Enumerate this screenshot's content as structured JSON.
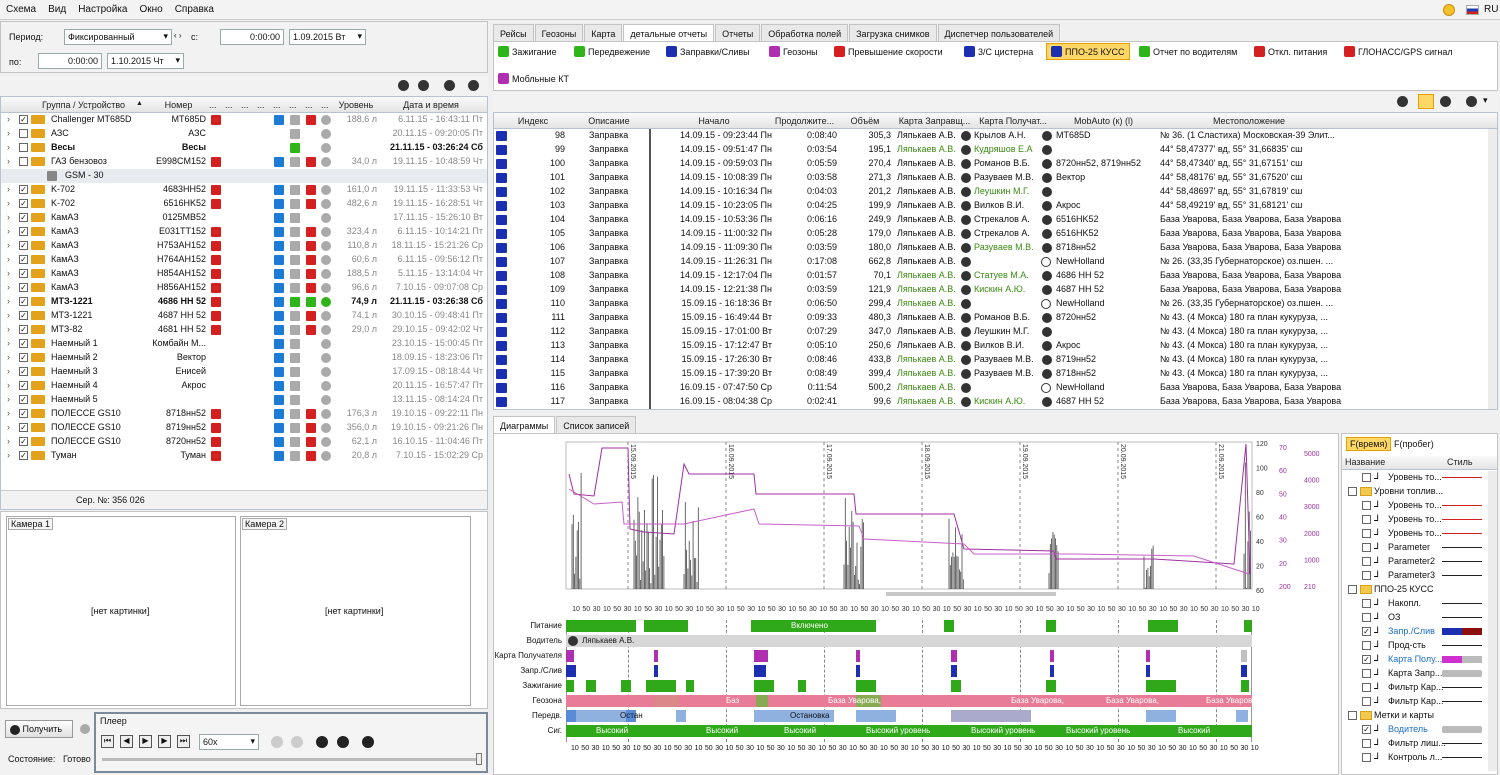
{
  "menu": [
    "Схема",
    "Вид",
    "Настройка",
    "Окно",
    "Справка"
  ],
  "locale": "RU",
  "period": {
    "label": "Период:",
    "mode": "Фиксированный",
    "from_label": "с:",
    "from_time": "0:00:00",
    "from_date": "1.09.2015 Вт",
    "to_label": "по:",
    "to_time": "0:00:00",
    "to_date": "1.10.2015 Чт"
  },
  "device_table": {
    "headers": {
      "group": "Группа / Устройство",
      "number": "Номер",
      "dots": "...",
      "level": "Уровень",
      "datetime": "Дата и время"
    },
    "rows": [
      {
        "name": "Challenger MT685D",
        "number": "MT685D",
        "level": "188,6 л",
        "dt": "6.11.15 - 16:43:11 Пт",
        "checked": true,
        "bold": false
      },
      {
        "name": "АЗС",
        "number": "АЗС",
        "level": "",
        "dt": "20.11.15 - 09:20:05 Пт",
        "checked": false,
        "bold": false
      },
      {
        "name": "Весы",
        "number": "Весы",
        "level": "",
        "dt": "21.11.15 - 03:26:24 Сб",
        "checked": false,
        "bold": true
      },
      {
        "name": "ГАЗ бензовоз",
        "number": "E998CM152",
        "level": "34,0 л",
        "dt": "19.11.15 - 10:48:59 Чт",
        "checked": false,
        "bold": false
      },
      {
        "name": "GSM - 30",
        "number": "",
        "level": "",
        "dt": "",
        "checked": false,
        "bold": false,
        "sub": true
      },
      {
        "name": "K-702",
        "number": "4683HH52",
        "level": "161,0 л",
        "dt": "19.11.15 - 11:33:53 Чт",
        "checked": true,
        "bold": false
      },
      {
        "name": "K-702",
        "number": "6516HK52",
        "level": "482,6 л",
        "dt": "19.11.15 - 16:28:51 Чт",
        "checked": true,
        "bold": false
      },
      {
        "name": "КамАЗ",
        "number": "0125MB52",
        "level": "",
        "dt": "17.11.15 - 15:26:10 Вт",
        "checked": true,
        "bold": false
      },
      {
        "name": "КамАЗ",
        "number": "E031TT152",
        "level": "323,4 л",
        "dt": "6.11.15 - 10:14:21 Пт",
        "checked": true,
        "bold": false
      },
      {
        "name": "КамАЗ",
        "number": "H753AH152",
        "level": "110,8 л",
        "dt": "18.11.15 - 15:21:26 Ср",
        "checked": true,
        "bold": false
      },
      {
        "name": "КамАЗ",
        "number": "H764AH152",
        "level": "60,6 л",
        "dt": "6.11.15 - 09:56:12 Пт",
        "checked": true,
        "bold": false
      },
      {
        "name": "КамАЗ",
        "number": "H854AH152",
        "level": "188,5 л",
        "dt": "5.11.15 - 13:14:04 Чт",
        "checked": true,
        "bold": false
      },
      {
        "name": "КамАЗ",
        "number": "H856AH152",
        "level": "96,6 л",
        "dt": "7.10.15 - 09:07:08 Ср",
        "checked": true,
        "bold": false
      },
      {
        "name": "МТЗ-1221",
        "number": "4686 HH 52",
        "level": "74,9 л",
        "dt": "21.11.15 - 03:26:38 Сб",
        "checked": true,
        "bold": true
      },
      {
        "name": "МТЗ-1221",
        "number": "4687 HH 52",
        "level": "74,1 л",
        "dt": "30.10.15 - 09:48:41 Пт",
        "checked": true,
        "bold": false
      },
      {
        "name": "МТЗ-82",
        "number": "4681 HH 52",
        "level": "29,0 л",
        "dt": "29.10.15 - 09:42:02 Чт",
        "checked": true,
        "bold": false
      },
      {
        "name": "Наемный 1",
        "number": "Комбайн М...",
        "level": "",
        "dt": "23.10.15 - 15:00:45 Пт",
        "checked": true,
        "bold": false
      },
      {
        "name": "Наемный 2",
        "number": "Вектор",
        "level": "",
        "dt": "18.09.15 - 18:23:06 Пт",
        "checked": true,
        "bold": false
      },
      {
        "name": "Наемный 3",
        "number": "Енисей",
        "level": "",
        "dt": "17.09.15 - 08:18:44 Чт",
        "checked": true,
        "bold": false
      },
      {
        "name": "Наемный 4",
        "number": "Акрос",
        "level": "",
        "dt": "20.11.15 - 16:57:47 Пт",
        "checked": true,
        "bold": false
      },
      {
        "name": "Наемный 5",
        "number": "",
        "level": "",
        "dt": "13.11.15 - 08:14:24 Пт",
        "checked": true,
        "bold": false
      },
      {
        "name": "ПОЛЕССЕ GS10",
        "number": "8718нн52",
        "level": "176,3 л",
        "dt": "19.10.15 - 09:22:11 Пн",
        "checked": true,
        "bold": false
      },
      {
        "name": "ПОЛЕССЕ GS10",
        "number": "8719нн52",
        "level": "356,0 л",
        "dt": "19.10.15 - 09:21:26 Пн",
        "checked": true,
        "bold": false
      },
      {
        "name": "ПОЛЕССЕ GS10",
        "number": "8720нн52",
        "level": "62,1 л",
        "dt": "16.10.15 - 11:04:46 Пт",
        "checked": true,
        "bold": false
      },
      {
        "name": "Туман",
        "number": "Туман",
        "level": "20,8 л",
        "dt": "7.10.15 - 15:02:29 Ср",
        "checked": true,
        "bold": false
      }
    ]
  },
  "serial": "Сер. №: 356 026",
  "cameras": {
    "cam1": "Камера 1",
    "cam2": "Камера 2",
    "no_image": "[нет картинки]"
  },
  "bottom": {
    "get": "Получить",
    "state_label": "Состояние:",
    "state": "Готово",
    "player": "Плеер",
    "speed": "60x"
  },
  "main_tabs": [
    "Рейсы",
    "Геозоны",
    "Карта",
    "детальные отчеты",
    "Отчеты",
    "Обработка полей",
    "Загрузка снимков",
    "Диспетчер пользователей"
  ],
  "report_buttons": [
    "Зажигание",
    "Передвежение",
    "Заправки/Сливы",
    "Геозоны",
    "Превышение скорости",
    "3/С цистерна",
    "ППО-25 КУСС",
    "Отчет по водителям",
    "Откл. питания",
    "ГЛОНАСС/GPS сигнал",
    "Мобльные КТ"
  ],
  "report_table": {
    "headers": [
      "Индекс",
      "Описание",
      "Начало",
      "Продолжите...",
      "Объём",
      "Карта Заправщ...",
      "Карта Получат...",
      "MobAuto (к) (l)",
      "Местоположение"
    ],
    "rows": [
      [
        "98",
        "Заправка",
        "14.09.15 - 09:23:44 Пн",
        "0:08:40",
        "305,3",
        "Ляпькаев А.В.",
        "Крылов А.Н.",
        "MT685D",
        "№ 36. (1 Сластиха) Московская-39 Элит..."
      ],
      [
        "99",
        "Заправка",
        "14.09.15 - 09:51:47 Пн",
        "0:03:54",
        "195,1",
        "Ляпькаев А.В.",
        "Кудряшов Е.А",
        "",
        "44° 58,47377' вд, 55° 31,66835' сш"
      ],
      [
        "100",
        "Заправка",
        "14.09.15 - 09:59:03 Пн",
        "0:05:59",
        "270,4",
        "Ляпькаев А.В.",
        "Романов В.Б.",
        "8720нн52, 8719нн52",
        "44° 58,47340' вд, 55° 31,67151' сш"
      ],
      [
        "101",
        "Заправка",
        "14.09.15 - 10:08:39 Пн",
        "0:03:58",
        "271,3",
        "Ляпькаев А.В.",
        "Разуваев М.В.",
        "Вектор",
        "44° 58,48176' вд, 55° 31,67520' сш"
      ],
      [
        "102",
        "Заправка",
        "14.09.15 - 10:16:34 Пн",
        "0:04:03",
        "201,2",
        "Ляпькаев А.В.",
        "Леушкин М.Г.",
        "",
        "44° 58,48697' вд, 55° 31,67819' сш"
      ],
      [
        "103",
        "Заправка",
        "14.09.15 - 10:23:05 Пн",
        "0:04:25",
        "199,9",
        "Ляпькаев А.В.",
        "Вилков В.И.",
        "Акрос",
        "44° 58,49219' вд, 55° 31,68121' сш"
      ],
      [
        "104",
        "Заправка",
        "14.09.15 - 10:53:36 Пн",
        "0:06:16",
        "249,9",
        "Ляпькаев А.В.",
        "Стрекалов А.",
        "6516HK52",
        "База Уварова, База Уварова, База Уварова"
      ],
      [
        "105",
        "Заправка",
        "14.09.15 - 11:00:32 Пн",
        "0:05:28",
        "179,0",
        "Ляпькаев А.В.",
        "Стрекалов А.",
        "6516HK52",
        "База Уварова, База Уварова, База Уварова"
      ],
      [
        "106",
        "Заправка",
        "14.09.15 - 11:09:30 Пн",
        "0:03:59",
        "180,0",
        "Ляпькаев А.В.",
        "Разуваев М.В.",
        "8718нн52",
        "База Уварова, База Уварова, База Уварова"
      ],
      [
        "107",
        "Заправка",
        "14.09.15 - 11:26:31 Пн",
        "0:17:08",
        "662,8",
        "Ляпькаев А.В.",
        "",
        "NewHolland",
        "№ 26. (33,35 Губернаторское) оз.пшен. ..."
      ],
      [
        "108",
        "Заправка",
        "14.09.15 - 12:17:04 Пн",
        "0:01:57",
        "70,1",
        "Ляпькаев А.В.",
        "Статуев М.А.",
        "4686 HH 52",
        "База Уварова, База Уварова, База Уварова"
      ],
      [
        "109",
        "Заправка",
        "14.09.15 - 12:21:38 Пн",
        "0:03:59",
        "121,9",
        "Ляпькаев А.В.",
        "Кискин А.Ю.",
        "4687 HH 52",
        "База Уварова, База Уварова, База Уварова"
      ],
      [
        "110",
        "Заправка",
        "15.09.15 - 16:18:36 Вт",
        "0:06:50",
        "299,4",
        "Ляпькаев А.В.",
        "",
        "NewHolland",
        "№ 26. (33,35 Губернаторское) оз.пшен. ..."
      ],
      [
        "111",
        "Заправка",
        "15.09.15 - 16:49:44 Вт",
        "0:09:33",
        "480,3",
        "Ляпькаев А.В.",
        "Романов В.Б.",
        "8720нн52",
        "№ 43. (4 Мокса) 180 га план кукуруза, ..."
      ],
      [
        "112",
        "Заправка",
        "15.09.15 - 17:01:00 Вт",
        "0:07:29",
        "347,0",
        "Ляпькаев А.В.",
        "Леушкин М.Г.",
        "",
        "№ 43. (4 Мокса) 180 га план кукуруза, ..."
      ],
      [
        "113",
        "Заправка",
        "15.09.15 - 17:12:47 Вт",
        "0:05:10",
        "250,6",
        "Ляпькаев А.В.",
        "Вилков В.И.",
        "Акрос",
        "№ 43. (4 Мокса) 180 га план кукуруза, ..."
      ],
      [
        "114",
        "Заправка",
        "15.09.15 - 17:26:30 Вт",
        "0:08:46",
        "433,8",
        "Ляпькаев А.В.",
        "Разуваев М.В.",
        "8719нн52",
        "№ 43. (4 Мокса) 180 га план кукуруза, ..."
      ],
      [
        "115",
        "Заправка",
        "15.09.15 - 17:39:20 Вт",
        "0:08:49",
        "399,4",
        "Ляпькаев А.В.",
        "Разуваев М.В.",
        "8718нн52",
        "№ 43. (4 Мокса) 180 га план кукуруза, ..."
      ],
      [
        "116",
        "Заправка",
        "16.09.15 - 07:47:50 Ср",
        "0:11:54",
        "500,2",
        "Ляпькаев А.В.",
        "",
        "NewHolland",
        "База Уварова, База Уварова, База Уварова"
      ],
      [
        "117",
        "Заправка",
        "16.09.15 - 08:04:38 Ср",
        "0:02:41",
        "99,6",
        "Ляпькаев А.В.",
        "Кискин А.Ю.",
        "4687 HH 52",
        "База Уварова, База Уварова, База Уварова"
      ]
    ],
    "green_cells": [
      [
        1,
        5
      ],
      [
        1,
        6
      ],
      [
        4,
        6
      ],
      [
        8,
        6
      ],
      [
        10,
        5
      ],
      [
        10,
        6
      ],
      [
        11,
        5
      ],
      [
        11,
        6
      ],
      [
        12,
        5
      ],
      [
        16,
        5
      ],
      [
        17,
        5
      ],
      [
        18,
        5
      ],
      [
        19,
        5
      ],
      [
        19,
        6
      ]
    ]
  },
  "lower_tabs": [
    "Диаграммы",
    "Список записей"
  ],
  "chart_data": {
    "type": "line",
    "date_labels": [
      "15.09.2015",
      "16.09.2015",
      "17.09.2015",
      "18.09.2015",
      "19.09.2015",
      "20.09.2015",
      "21.09.2015"
    ],
    "y_axes": {
      "a": [
        120,
        100,
        80,
        60,
        40,
        20,
        60
      ],
      "b": [
        70,
        60,
        50,
        40,
        30,
        20,
        200
      ],
      "c": [
        5000,
        4000,
        3000,
        2000,
        1000,
        210
      ]
    },
    "x_ticks": [
      "10",
      "50",
      "30",
      "10",
      "50",
      "30",
      "10",
      "50",
      "30",
      "10",
      "50",
      "30",
      "10",
      "50",
      "30",
      "10",
      "50",
      "30",
      "10",
      "50",
      "30",
      "10",
      "50",
      "30",
      "10",
      "50",
      "30",
      "10",
      "50",
      "30",
      "10",
      "50",
      "30",
      "10",
      "50",
      "30",
      "10",
      "50",
      "30",
      "10",
      "50",
      "30",
      "10",
      "50",
      "30",
      "10",
      "50",
      "30",
      "10",
      "50",
      "30",
      "10",
      "50",
      "30",
      "10",
      "50",
      "30",
      "10",
      "50",
      "30",
      "10",
      "50",
      "30",
      "10",
      "50",
      "30",
      "10"
    ]
  },
  "tracks": {
    "labels": [
      "Питание",
      "Водитель",
      "Карта Получателя",
      "Запр./Слив",
      "Зажигание",
      "Геозона",
      "Передв.",
      "Сиг."
    ],
    "driver": "Ляпькаев А.В.",
    "texts": {
      "on": "Включено",
      "geo": "База Уварова,",
      "geo_short": "Баз",
      "stop": "Остан",
      "stop2": "Остановка",
      "sig": "Высокий",
      "sig2": "Высокий уровень"
    }
  },
  "right_panel": {
    "modes": [
      "F(время)",
      "F(пробег)"
    ],
    "headers": [
      "Название",
      "Стиль"
    ],
    "items": [
      {
        "label": "Уровень то...",
        "indent": 2,
        "style": "red"
      },
      {
        "label": "Уровни топлив...",
        "indent": 1,
        "style": "",
        "folder": true
      },
      {
        "label": "Уровень то...",
        "indent": 2,
        "style": "red"
      },
      {
        "label": "Уровень то...",
        "indent": 2,
        "style": "red"
      },
      {
        "label": "Уровень то...",
        "indent": 2,
        "style": "red"
      },
      {
        "label": "Parameter",
        "indent": 2,
        "style": "dark"
      },
      {
        "label": "Parameter2",
        "indent": 2,
        "style": "dark"
      },
      {
        "label": "Parameter3",
        "indent": 2,
        "style": "dark"
      },
      {
        "label": "ППО-25 КУСС",
        "indent": 1,
        "style": "",
        "folder": true
      },
      {
        "label": "Накопл.",
        "indent": 2,
        "style": "dark"
      },
      {
        "label": "ОЗ",
        "indent": 2,
        "style": "dark"
      },
      {
        "label": "Запр./Слив",
        "indent": 2,
        "style": "bluered",
        "checked": true,
        "blue": true
      },
      {
        "label": "Прод-сть",
        "indent": 2,
        "style": "dark"
      },
      {
        "label": "Карта Полу...",
        "indent": 2,
        "style": "magenta",
        "checked": true,
        "blue": true
      },
      {
        "label": "Карта Запр...",
        "indent": 2,
        "style": "gray"
      },
      {
        "label": "Фильтр Кар...",
        "indent": 2,
        "style": "dark"
      },
      {
        "label": "Фильтр Кар...",
        "indent": 2,
        "style": "dark"
      },
      {
        "label": "Метки и карты",
        "indent": 1,
        "style": "",
        "folder": true
      },
      {
        "label": "Водитель",
        "indent": 2,
        "style": "gray",
        "checked": true,
        "blue": true
      },
      {
        "label": "Фильтр лиш...",
        "indent": 2,
        "style": "dark"
      },
      {
        "label": "Контроль л...",
        "indent": 2,
        "style": "dark"
      }
    ]
  },
  "colors": {
    "accent": "#1e7ad7",
    "green": "#2fb51a",
    "red": "#d42020",
    "magenta": "#b02fb0",
    "blue": "#1c2fb0",
    "pink": "#e87b96"
  }
}
